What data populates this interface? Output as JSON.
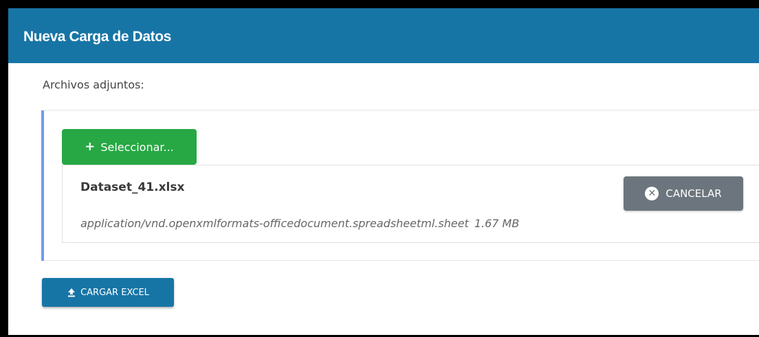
{
  "header": {
    "title": "Nueva Carga de Datos",
    "background": "#1775a6"
  },
  "attachments": {
    "label": "Archivos adjuntos:"
  },
  "upload": {
    "select_label": "Seleccionar...",
    "select_icon": "plus-icon",
    "select_color": "#27a844",
    "file": {
      "name": "Dataset_41.xlsx",
      "type": "application/vnd.openxmlformats-officedocument.spreadsheetml.sheet",
      "size": "1.67 MB"
    },
    "cancel_label": "CANCELAR",
    "cancel_icon": "x-circle-icon",
    "cancel_color": "#6c757d"
  },
  "actions": {
    "upload_excel_label": "CARGAR EXCEL",
    "upload_icon": "upload-icon"
  }
}
